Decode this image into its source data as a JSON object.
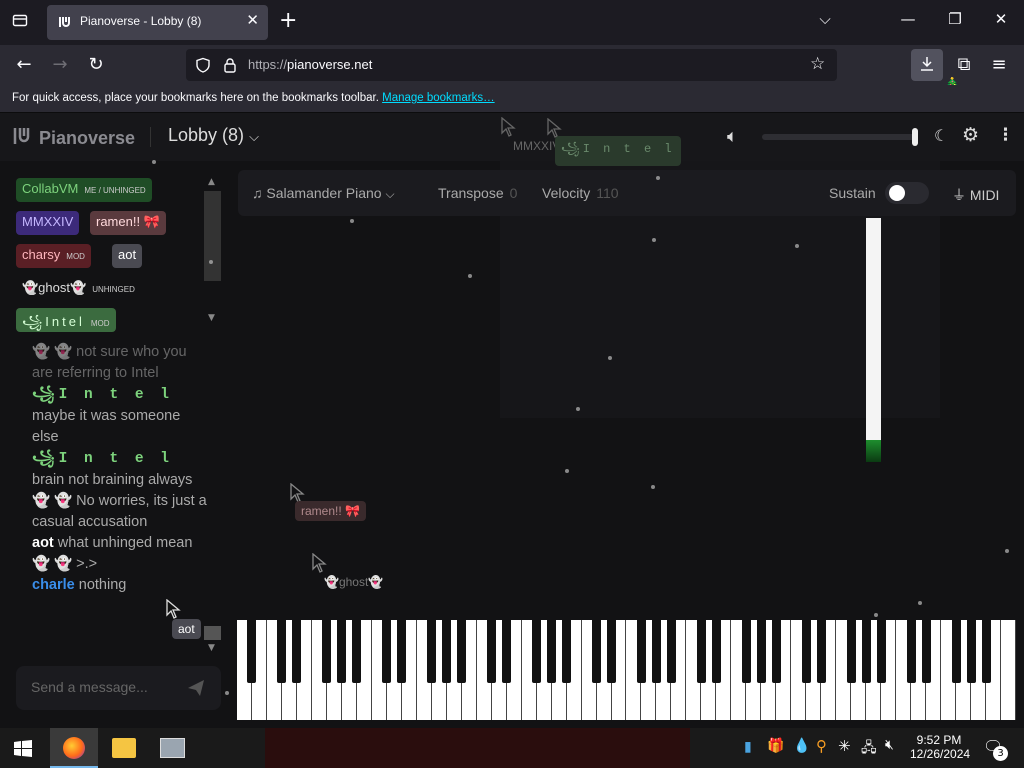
{
  "browser": {
    "tab_title": "Pianoverse - Lobby (8)",
    "url_prefix": "https://",
    "url_host": "pianoverse.net",
    "bookmark_prompt": "For quick access, place your bookmarks here on the bookmarks toolbar.",
    "bookmark_link": "Manage bookmarks…"
  },
  "app": {
    "logo": "Pianoverse",
    "room": "Lobby (8)"
  },
  "users": [
    {
      "name": "CollabVM",
      "badge": "ME / UNHINGED",
      "bg": "#1f4d26",
      "color": "#7dd37d"
    },
    {
      "name": "MMXXIV",
      "badge": "",
      "bg": "#3c2a7a",
      "color": "#c4b6ff"
    },
    {
      "name": "ramen!! 🎀",
      "badge": "",
      "bg": "#5a3a3e",
      "color": "#ffd9dc"
    },
    {
      "name": "charsy",
      "badge": "MOD",
      "bg": "#5a1f25",
      "color": "#ffb6bd"
    },
    {
      "name": "aot",
      "badge": "",
      "bg": "#4a4a52",
      "color": "#ffffff"
    },
    {
      "name": "👻ghost👻",
      "badge": "UNHINGED",
      "bg": "transparent",
      "color": "#dddddd"
    },
    {
      "name": "꧁Intel",
      "badge": "MOD",
      "bg": "#3b6b3f",
      "color": "#d7ffd7"
    }
  ],
  "chat": [
    {
      "name": "👻 👻",
      "text": "not sure who you are referring to Intel"
    },
    {
      "name": "꧁I n t e l",
      "text": "maybe it was someone else"
    },
    {
      "name": "꧁I n t e l",
      "text": "brain not braining always"
    },
    {
      "name": "👻 👻",
      "text": "No worries, its just a casual accusation"
    },
    {
      "name": "aot",
      "text": "what unhinged mean"
    },
    {
      "name": "👻 👻",
      "text": ">.>"
    },
    {
      "name": "charle",
      "text": "nothing"
    }
  ],
  "chat_placeholder": "Send a message...",
  "toolbar": {
    "instrument": "Salamander Piano",
    "transpose_label": "Transpose",
    "transpose_value": "0",
    "velocity_label": "Velocity",
    "velocity_value": "110",
    "sustain_label": "Sustain",
    "midi_label": "MIDI"
  },
  "cursors": [
    {
      "name": "ramen!! 🎀"
    },
    {
      "name": "👻ghost👻"
    },
    {
      "name": "aot"
    },
    {
      "name": "MMXXIV"
    },
    {
      "name": "꧁I n t e l"
    }
  ],
  "taskbar": {
    "time": "9:52 PM",
    "date": "12/26/2024",
    "notification_count": "3"
  }
}
